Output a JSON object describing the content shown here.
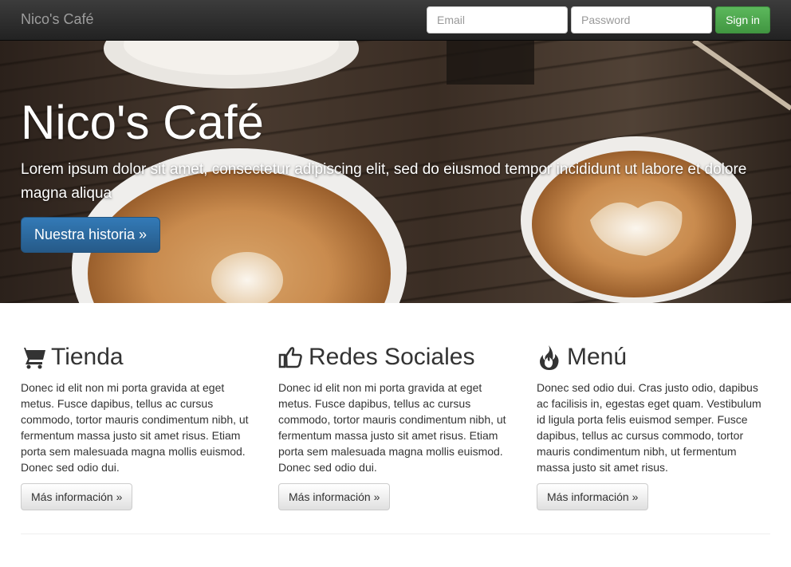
{
  "navbar": {
    "brand": "Nico's Café",
    "email_placeholder": "Email",
    "password_placeholder": "Password",
    "signin_label": "Sign in"
  },
  "hero": {
    "title": "Nico's Café",
    "lead": "Lorem ipsum dolor sit amet, consectetur adipiscing elit, sed do eiusmod tempor incididunt ut labore et dolore magna aliqua",
    "button_label": "Nuestra historia »"
  },
  "columns": [
    {
      "icon": "shopping-cart-icon",
      "heading": "Tienda",
      "text": "Donec id elit non mi porta gravida at eget metus. Fusce dapibus, tellus ac cursus commodo, tortor mauris condimentum nibh, ut fermentum massa justo sit amet risus. Etiam porta sem malesuada magna mollis euismod. Donec sed odio dui.",
      "button_label": "Más información »"
    },
    {
      "icon": "thumbs-up-icon",
      "heading": "Redes Sociales",
      "text": "Donec id elit non mi porta gravida at eget metus. Fusce dapibus, tellus ac cursus commodo, tortor mauris condimentum nibh, ut fermentum massa justo sit amet risus. Etiam porta sem malesuada magna mollis euismod. Donec sed odio dui.",
      "button_label": "Más información »"
    },
    {
      "icon": "fire-icon",
      "heading": "Menú",
      "text": "Donec sed odio dui. Cras justo odio, dapibus ac facilisis in, egestas eget quam. Vestibulum id ligula porta felis euismod semper. Fusce dapibus, tellus ac cursus commodo, tortor mauris condimentum nibh, ut fermentum massa justo sit amet risus.",
      "button_label": "Más información »"
    }
  ],
  "colors": {
    "navbar_bg": "#222222",
    "brand_text": "#9d9d9d",
    "signin_green": "#5cb85c",
    "primary_blue": "#337ab7"
  }
}
